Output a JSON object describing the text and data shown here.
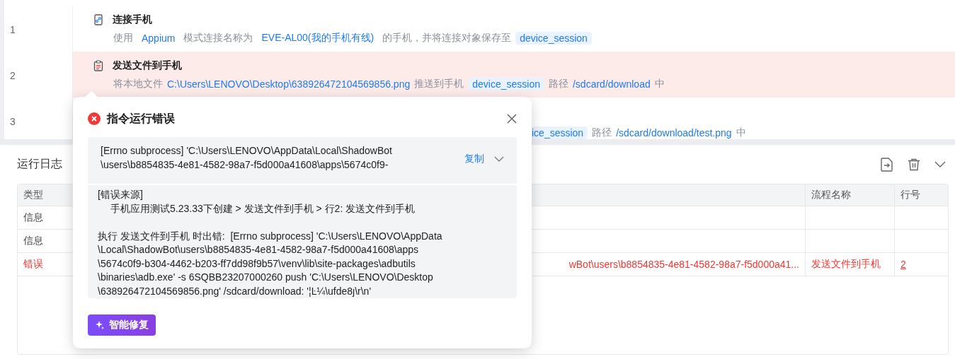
{
  "steps": [
    {
      "number": "1",
      "kind": "connect",
      "title": "连接手机",
      "highlighted": false,
      "segments": [
        {
          "kind": "plain",
          "text": "使用"
        },
        {
          "kind": "value",
          "text": "Appium"
        },
        {
          "kind": "plain",
          "text": "模式连接名称为"
        },
        {
          "kind": "value",
          "text": "EVE-AL00(我的手机有线)"
        },
        {
          "kind": "plain",
          "text": "的手机，并将连接对象保存至"
        },
        {
          "kind": "var",
          "text": "device_session"
        }
      ]
    },
    {
      "number": "2",
      "kind": "file",
      "title": "发送文件到手机",
      "highlighted": true,
      "segments": [
        {
          "kind": "plain",
          "text": "将本地文件"
        },
        {
          "kind": "link",
          "text": "C:\\Users\\LENOVO\\Desktop\\638926472104569856.png"
        },
        {
          "kind": "plain",
          "text": "推送到手机"
        },
        {
          "kind": "var",
          "text": "device_session"
        },
        {
          "kind": "plain",
          "text": "路径"
        },
        {
          "kind": "link",
          "text": "/sdcard/download"
        },
        {
          "kind": "plain",
          "text": "中"
        }
      ]
    },
    {
      "number": "3",
      "kind": "covered",
      "highlighted": false,
      "segments": [
        {
          "kind": "var",
          "text": "ice_session"
        },
        {
          "kind": "plain",
          "text": "路径"
        },
        {
          "kind": "link",
          "text": "/sdcard/download/test.png"
        },
        {
          "kind": "plain",
          "text": "中"
        }
      ]
    }
  ],
  "log": {
    "title": "运行日志",
    "columns": [
      "类型",
      "流程名称",
      "行号"
    ],
    "rows": [
      {
        "kind": "info",
        "type": "信息"
      },
      {
        "kind": "info",
        "type": "信息"
      },
      {
        "kind": "error",
        "type": "错误",
        "message": "wBot\\users\\b8854835-4e81-4582-98a7-f5d000a41...",
        "flow": "发送文件到手机",
        "line": "2"
      }
    ]
  },
  "popup": {
    "title": "指令运行错误",
    "summary_lines": [
      "[Errno subprocess] 'C:\\Users\\LENOVO\\AppData\\Local\\ShadowBot",
      "\\users\\b8854835-4e81-4582-98a7-f5d000a41608\\apps\\5674c0f9-"
    ],
    "copy": "复制",
    "source_heading": "[错误来源]",
    "source_path": "手机应用测试5.23.33下创建 > 发送文件到手机 > 行2: 发送文件到手机",
    "message_lines": [
      "执行 发送文件到手机 时出错:  [Errno subprocess] 'C:\\Users\\LENOVO\\AppData",
      "\\Local\\ShadowBot\\users\\b8854835-4e81-4582-98a7-f5d000a41608\\apps",
      "\\5674c0f9-b304-4462-b203-ff7dd98f9b57\\venv\\lib\\site-packages\\adbutils",
      "\\binaries\\adb.exe' -s 6SQBB23207000260 push 'C:\\Users\\LENOVO\\Desktop",
      "\\638926472104569856.png' /sdcard/download: '¦Ŀ¼\\ufde8ȷ\\r\\n'"
    ],
    "fix_button": "智能修复"
  }
}
